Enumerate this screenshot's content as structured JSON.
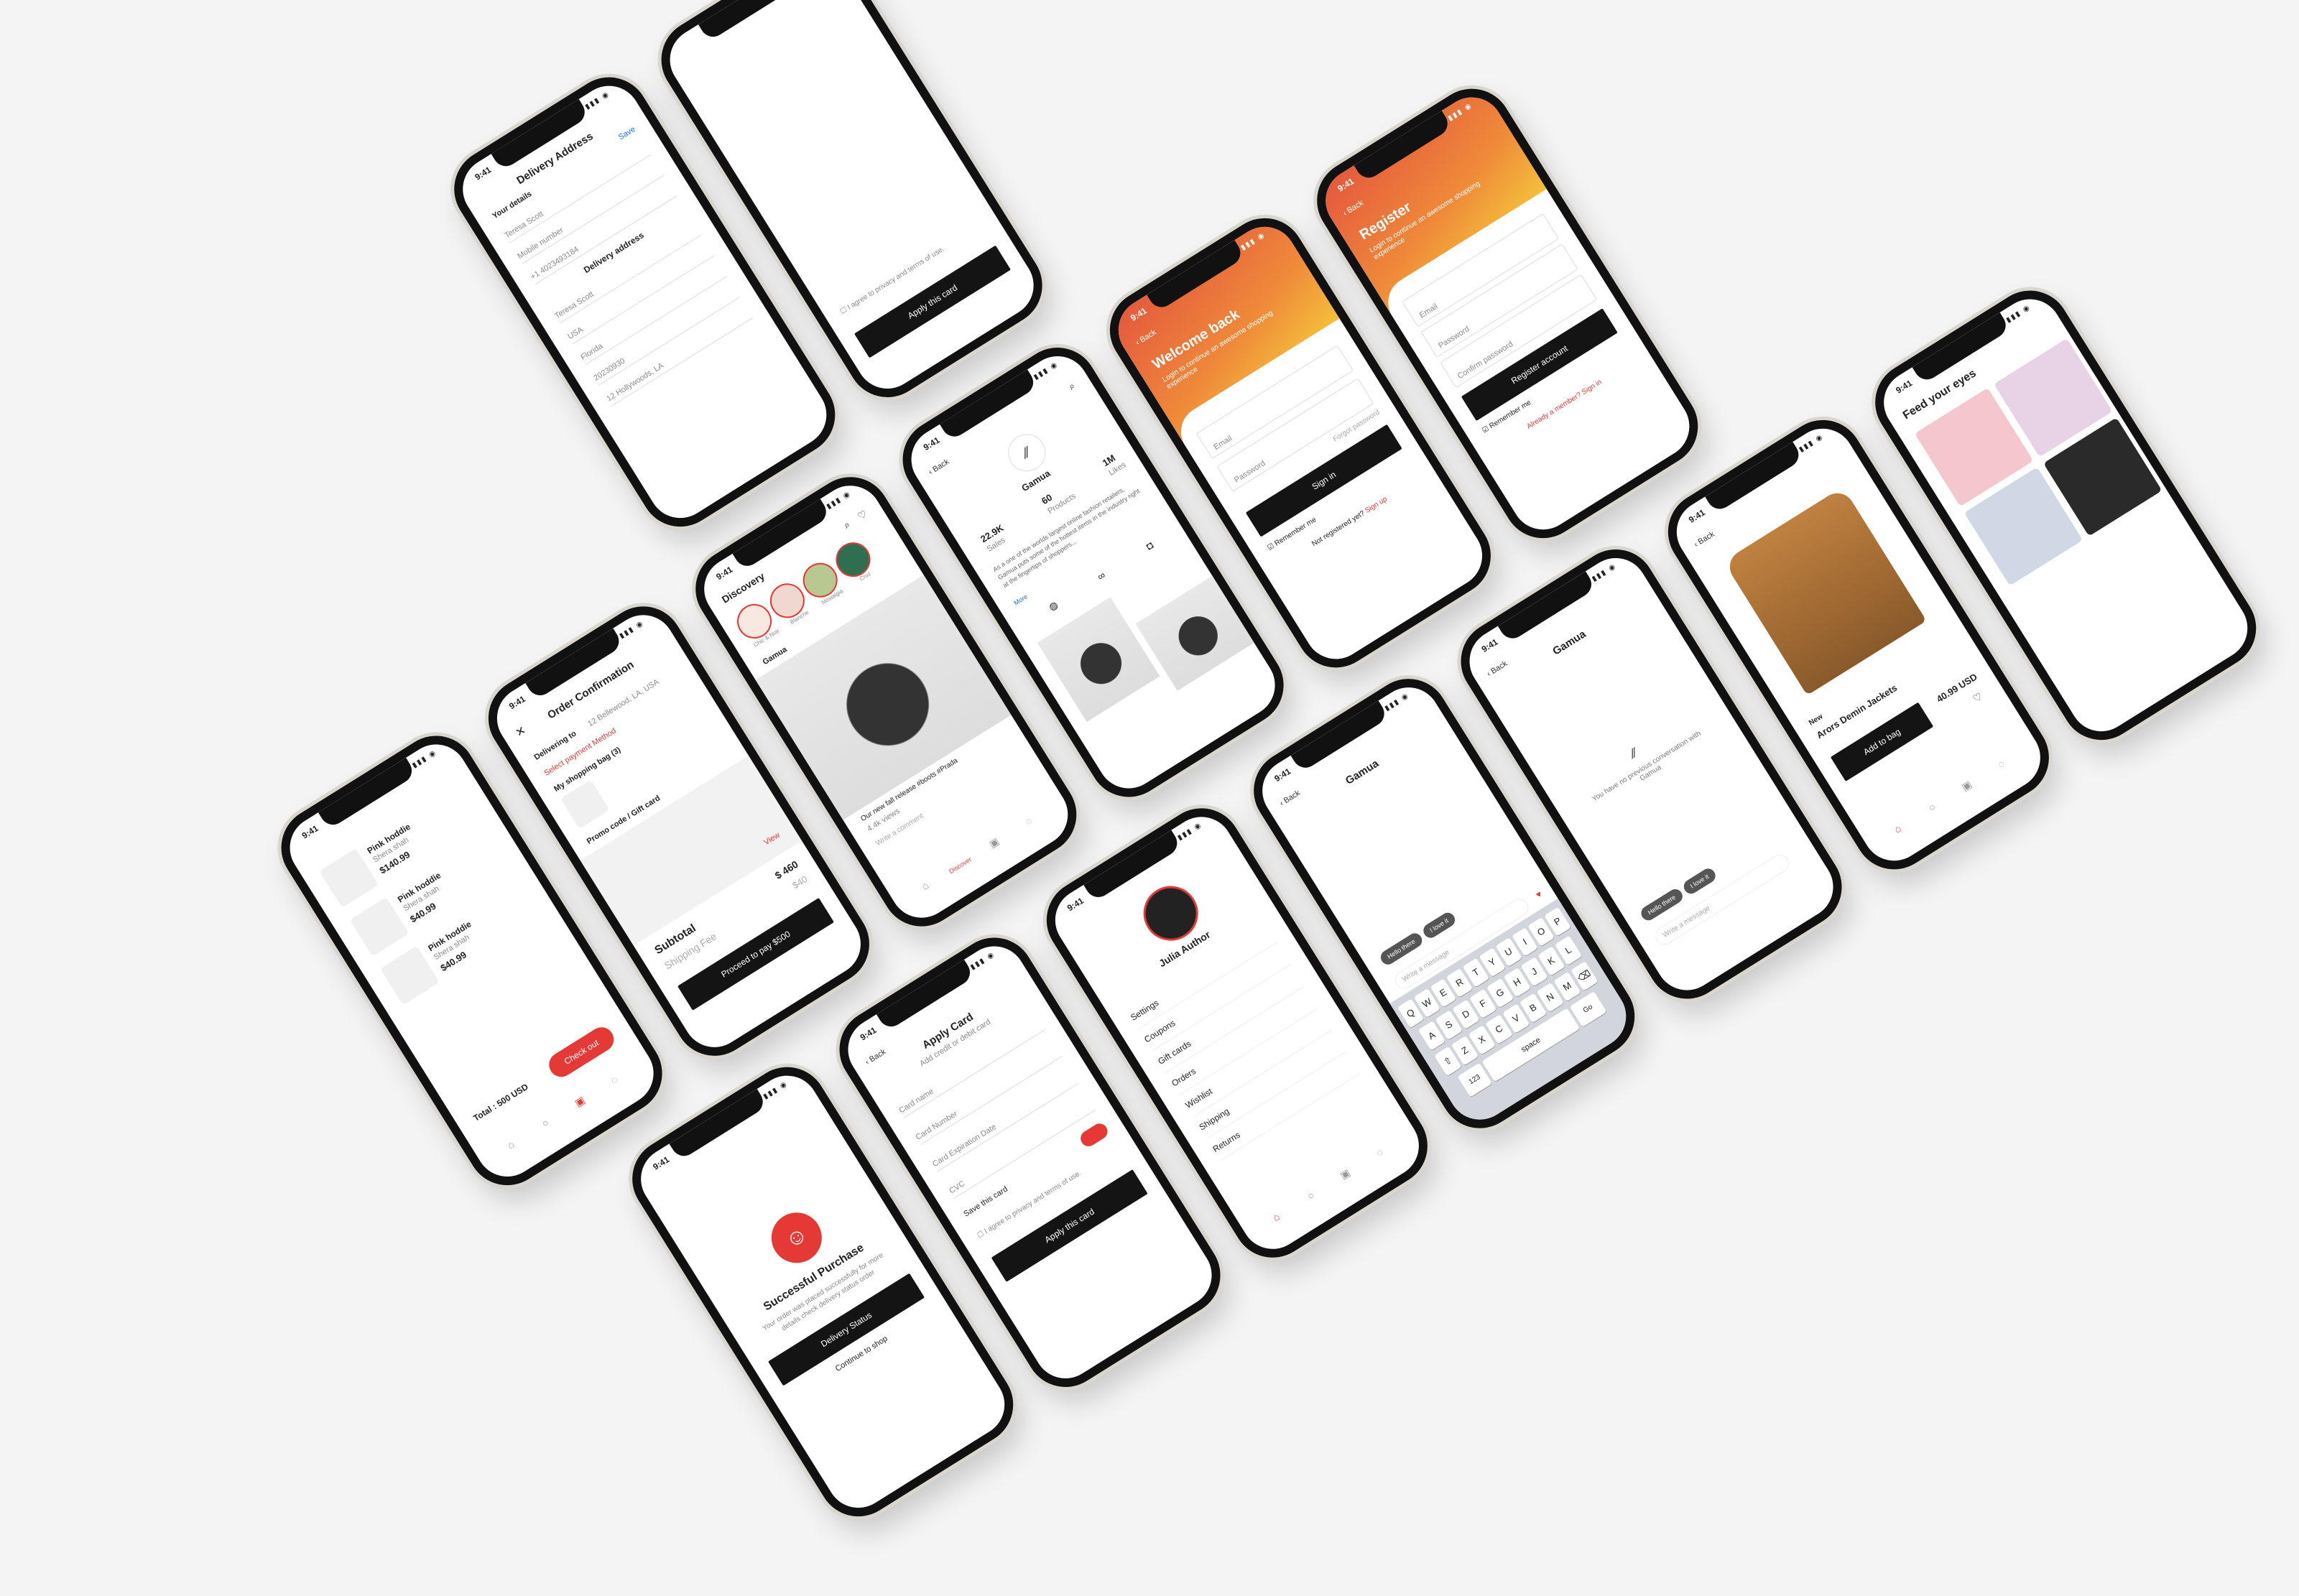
{
  "status": {
    "time": "9:41"
  },
  "cart": {
    "items": [
      {
        "name": "Pink hoddie",
        "variant": "Shera shah",
        "price": "$140.99"
      },
      {
        "name": "Pink hoddie",
        "variant": "Shera shah",
        "price": "$40.99"
      },
      {
        "name": "Pink hoddie",
        "variant": "Shera shah",
        "price": "$40.99"
      }
    ],
    "total": "Total : 500 USD",
    "checkout": "Check out"
  },
  "order": {
    "title": "Order Confirmation",
    "delivering_to": "Delivering to",
    "address": "12 Bellewood, LA, USA",
    "payment": "Select payment Method",
    "bag": "My shopping bag (3)",
    "promo": "Promo code / Gift card",
    "view": "View",
    "subtotal": "Subtotal",
    "subtotal_value": "$ 460",
    "shipping": "Shipping Fee",
    "shipping_value": "$40",
    "pay": "Proceed to pay $500"
  },
  "card_top": {
    "apply": "Apply this card",
    "terms": "I agree to privacy and terms of use."
  },
  "delivery": {
    "title": "Delivery Address",
    "your_details": "Your details",
    "save": "Save",
    "fields": [
      "Teresa Scott",
      "Mobile number",
      "+1   4023493184"
    ],
    "address_title": "Delivery address",
    "address_fields": [
      "Teresa Scott",
      "USA",
      "Florida",
      "20230930",
      "12 Hollywoods, LA"
    ],
    "address_labels": [
      "Home Address",
      "Country",
      "Region",
      "Postcode",
      "Delivery Home address"
    ]
  },
  "keyboard": {
    "rows": [
      [
        "Q",
        "W",
        "E",
        "R",
        "T",
        "Y",
        "U",
        "I",
        "O",
        "P"
      ],
      [
        "A",
        "S",
        "D",
        "F",
        "G",
        "H",
        "J",
        "K",
        "L"
      ],
      [
        "Z",
        "X",
        "C",
        "V",
        "B",
        "N",
        "M"
      ]
    ],
    "num": "123",
    "space": "space",
    "go": "Go"
  },
  "success": {
    "title": "Successful Purchase",
    "desc": "Your order was placed successfully for more details check delivery status order",
    "btn": "Delivery Status",
    "link": "Continue to shop"
  },
  "discovery": {
    "title": "Discovery",
    "stories": [
      "Chic & Noir",
      "Blanche",
      "Nostalgia",
      "Cruz"
    ],
    "brand": "Gamua",
    "caption": "Our new fall release #boots #Prada",
    "views": "4.4k views",
    "comment": "Write a comment",
    "tab": "Discover"
  },
  "profile": {
    "back": "Back",
    "name": "Gamua",
    "sales": "22.9K",
    "sales_label": "Sales",
    "products": "60",
    "products_label": "Products",
    "likes": "1M",
    "likes_label": "Likes",
    "bio": "As a one of the worlds largest online fashion retailers, Gamua puts some of the hottest items in the industry right at the fingertips of shoppers...",
    "more": "More"
  },
  "login": {
    "back": "Back",
    "title": "Welcome back",
    "subtitle": "Login to continue an awesome shopping experience",
    "email": "Email",
    "password": "Password",
    "forgot": "Forgot password",
    "signin": "Sign in",
    "remember": "Remember me",
    "not_registered": "Not registered yet?",
    "signup": "Sign up"
  },
  "register": {
    "back": "Back",
    "title": "Register",
    "subtitle": "Login to continue an awesome shopping experience",
    "email": "Email",
    "password": "Password",
    "confirm": "Confirm password",
    "btn": "Register account",
    "remember": "Remember me",
    "already": "Already a member?",
    "signin": "Sign in"
  },
  "chat": {
    "back": "Back",
    "title": "Gamua",
    "empty": "You have no previous conversation with Gamua",
    "quick": [
      "Hello there",
      "I love it"
    ],
    "write": "Write a message"
  },
  "apply_card": {
    "back": "Back",
    "title": "Apply Card",
    "subtitle": "Add credit or debit card",
    "fields": [
      "Card name",
      "Card Number",
      "Card Expiration Date",
      "CVC"
    ],
    "save": "Save this card",
    "agree": "I agree to privacy and terms of use.",
    "btn": "Apply this card"
  },
  "account": {
    "name": "Julia Author",
    "menu": [
      "Settings",
      "Coupons",
      "Gift cards",
      "Orders",
      "Wishlist",
      "Shipping",
      "Returns"
    ],
    "home": "Home"
  },
  "product": {
    "back": "Back",
    "badge": "New",
    "name": "Arors Demin Jackets",
    "price": "40.99 USD",
    "add": "Add to bag"
  },
  "feed": {
    "title": "Feed your eyes"
  },
  "colors": {
    "accent": "#e53935",
    "dark": "#141414"
  }
}
